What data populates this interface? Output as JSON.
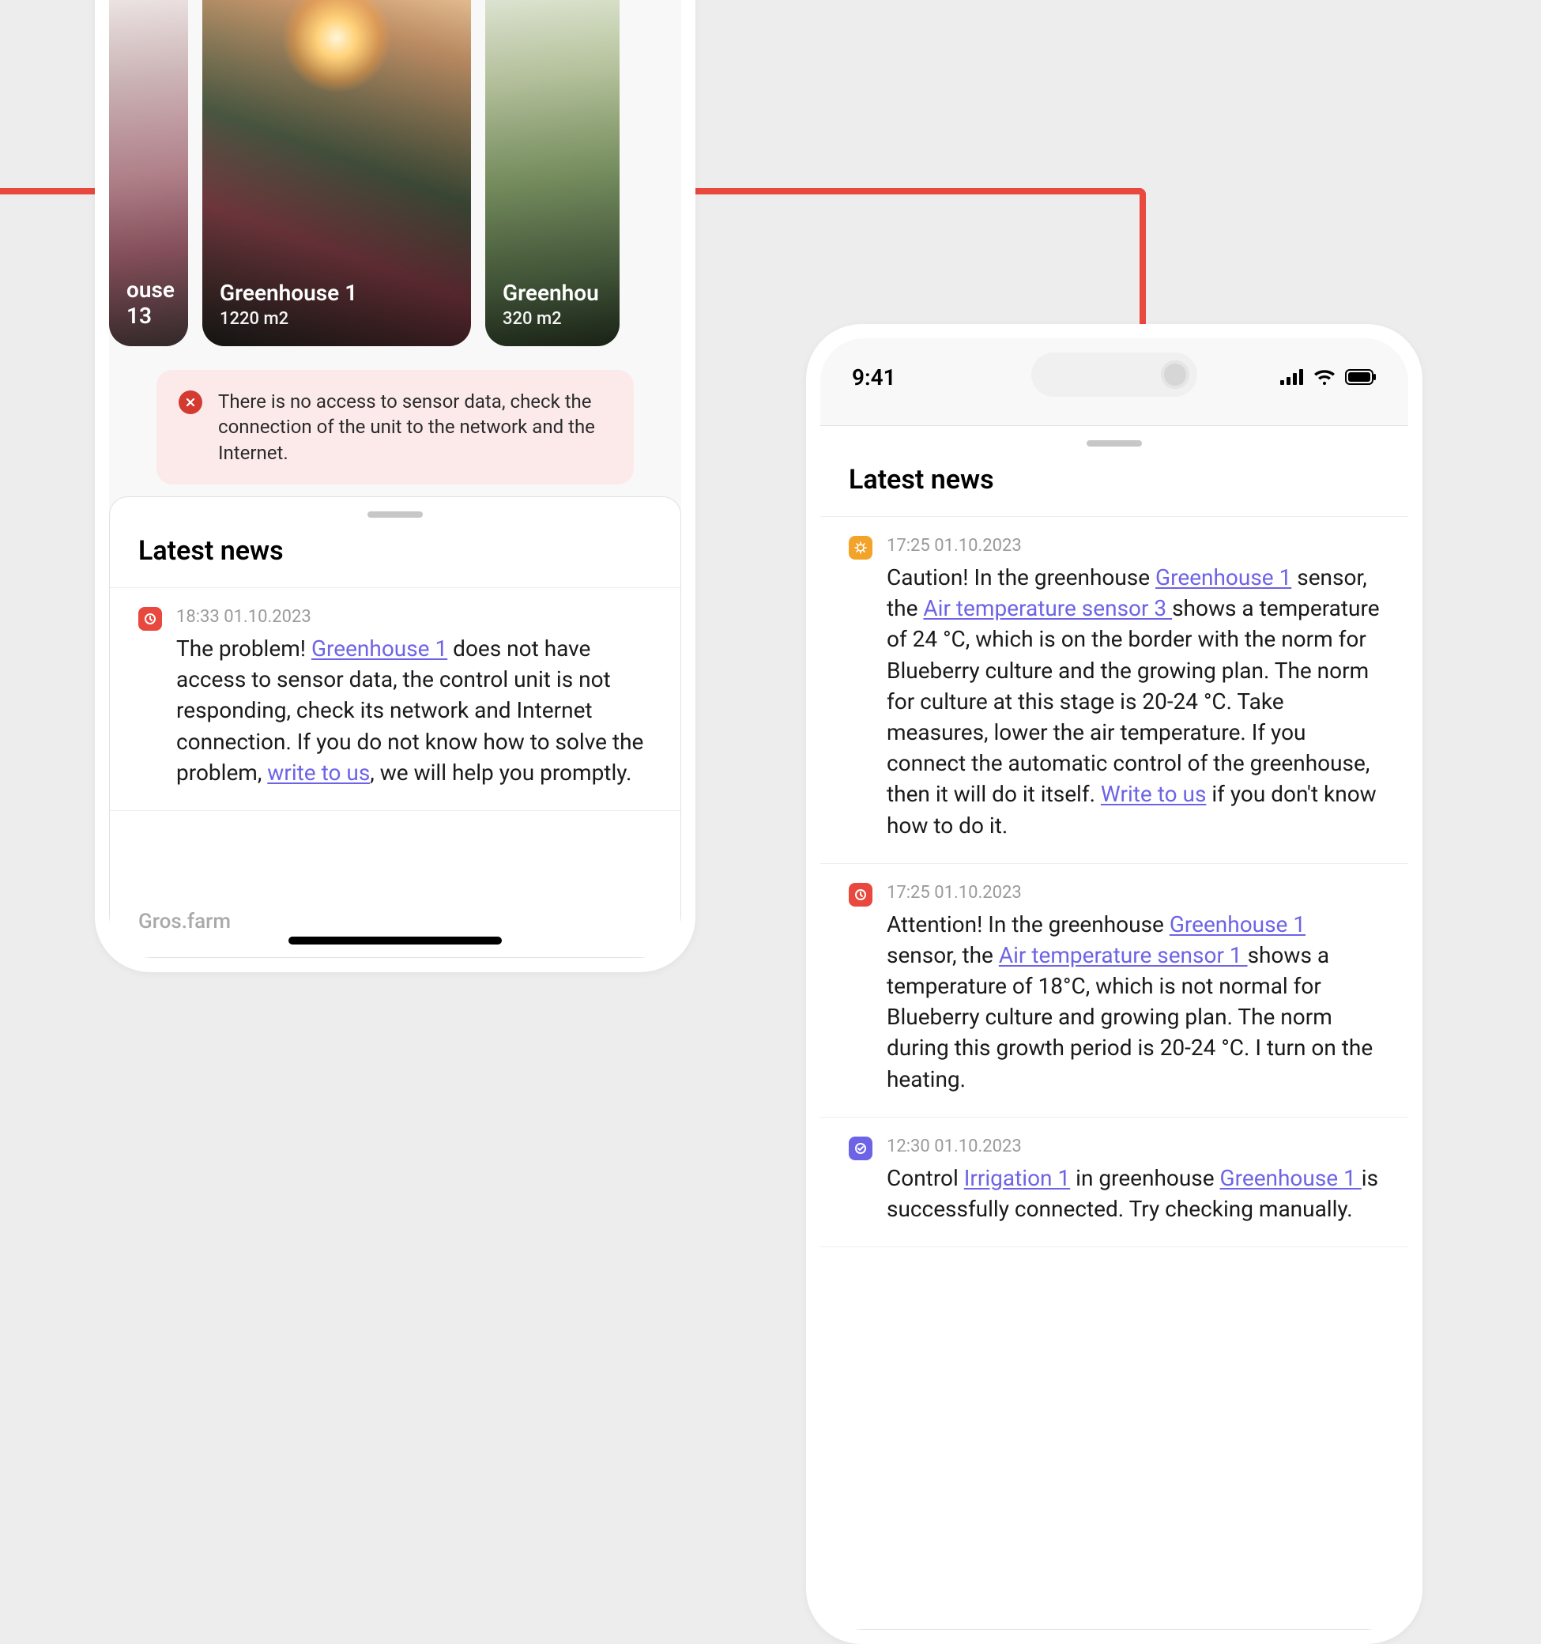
{
  "status": {
    "time": "9:41"
  },
  "carousel": {
    "left": {
      "title": "ouse 13"
    },
    "center": {
      "title": "Greenhouse 1",
      "area": "1220 m2"
    },
    "right": {
      "title": "Greenhou",
      "area": "320 m2"
    }
  },
  "alert": {
    "text": "There is no access to sensor data, check the connection of the unit to the network and the Internet."
  },
  "latest_title": "Latest news",
  "phone1": {
    "news": [
      {
        "time": "18:33 01.10.2023",
        "severity": "red",
        "html": "The problem! <a href='#'>Greenhouse 1</a> does not have access to sensor data, the control unit is not responding, check its network and Internet connection. If you do not know how to solve the problem, <a href='#'>write to us</a>, we will help you promptly."
      }
    ],
    "brand": "Gros.farm"
  },
  "phone2": {
    "news": [
      {
        "time": "17:25 01.10.2023",
        "severity": "orange",
        "html": "Caution! In the greenhouse <a href='#'>Greenhouse 1</a> sensor, the <a href='#'>Air temperature sensor 3 </a>shows a temperature of 24 °C, which is on the border with the norm for Blueberry culture and the growing plan. The norm for culture at this stage is 20-24 °C. Take measures, lower the air temperature. If you connect the automatic control of the greenhouse, then it will do it itself. <a href='#'>Write to us</a> if you don't know how to do it."
      },
      {
        "time": "17:25 01.10.2023",
        "severity": "red",
        "html": "Attention! In the greenhouse <a href='#'>Greenhouse 1</a> sensor, the <a href='#'>Air temperature sensor 1 </a>shows a temperature of 18°C, which is not normal for Blueberry culture and growing plan. The norm during this growth period is 20-24 °C. I turn on the heating."
      },
      {
        "time": "12:30 01.10.2023",
        "severity": "purple",
        "html": "Control <a href='#'>Irrigation 1</a> in greenhouse <a href='#'>Greenhouse 1 </a>is successfully connected. Try checking manually."
      }
    ]
  }
}
